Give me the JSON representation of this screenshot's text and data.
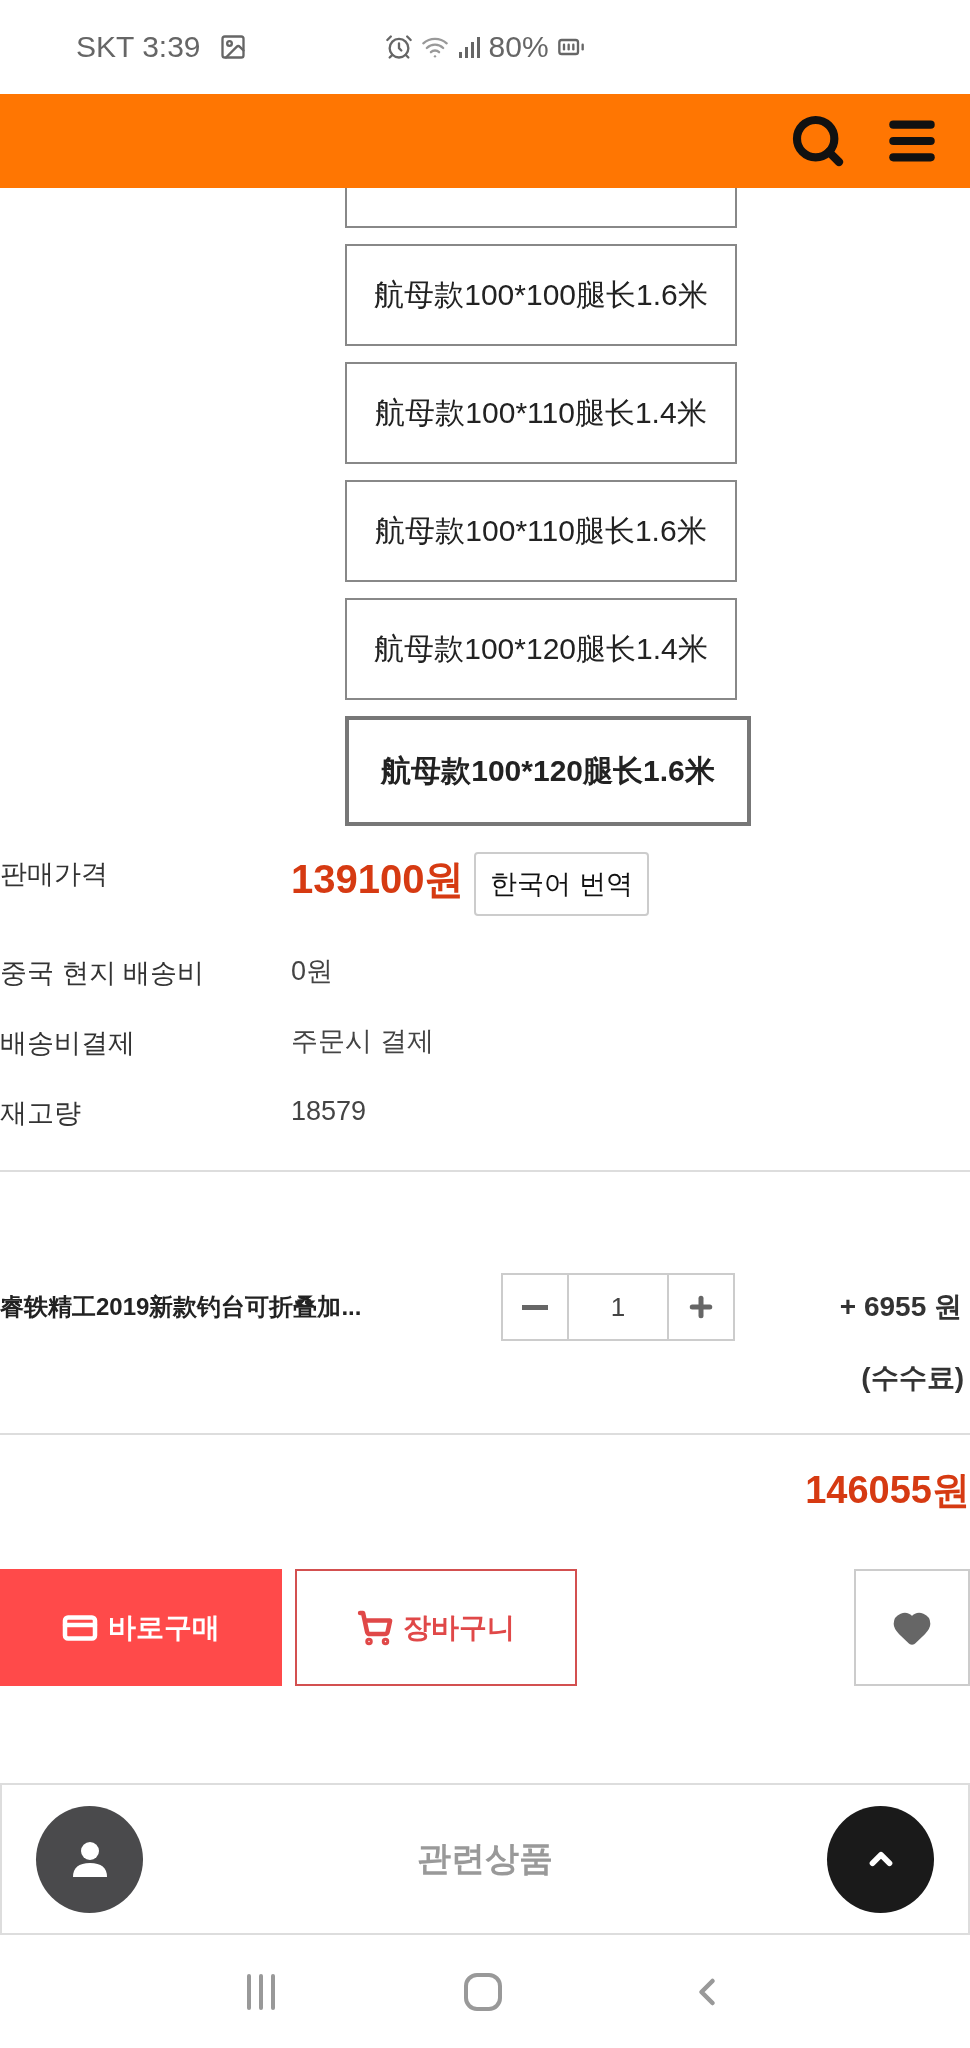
{
  "status_bar": {
    "carrier_time": "SKT 3:39",
    "battery": "80%"
  },
  "options": [
    {
      "label": "航母款100*100腿长1.6米",
      "selected": false
    },
    {
      "label": "航母款100*110腿长1.4米",
      "selected": false
    },
    {
      "label": "航母款100*110腿长1.6米",
      "selected": false
    },
    {
      "label": "航母款100*120腿长1.4米",
      "selected": false
    },
    {
      "label": "航母款100*120腿长1.6米",
      "selected": true
    }
  ],
  "details": [
    {
      "kind": "price",
      "label": "판매가격",
      "value": "139100원",
      "action": "한국어 번역"
    },
    {
      "kind": "text",
      "label": "중국 현지 배송비",
      "value": "0원"
    },
    {
      "kind": "text",
      "label": "배송비결제",
      "value": "주문시 결제"
    },
    {
      "kind": "text",
      "label": "재고량",
      "value": "18579"
    }
  ],
  "item": {
    "name": "睿轶精工2019新款钓台可折叠加...",
    "quantity": "1",
    "fee": "+ 6955 원",
    "fee_note": "(수수료)"
  },
  "total": "146055원",
  "buttons": {
    "buy": "바로구매",
    "cart": "장바구니"
  },
  "related": {
    "label": "관련상품"
  }
}
